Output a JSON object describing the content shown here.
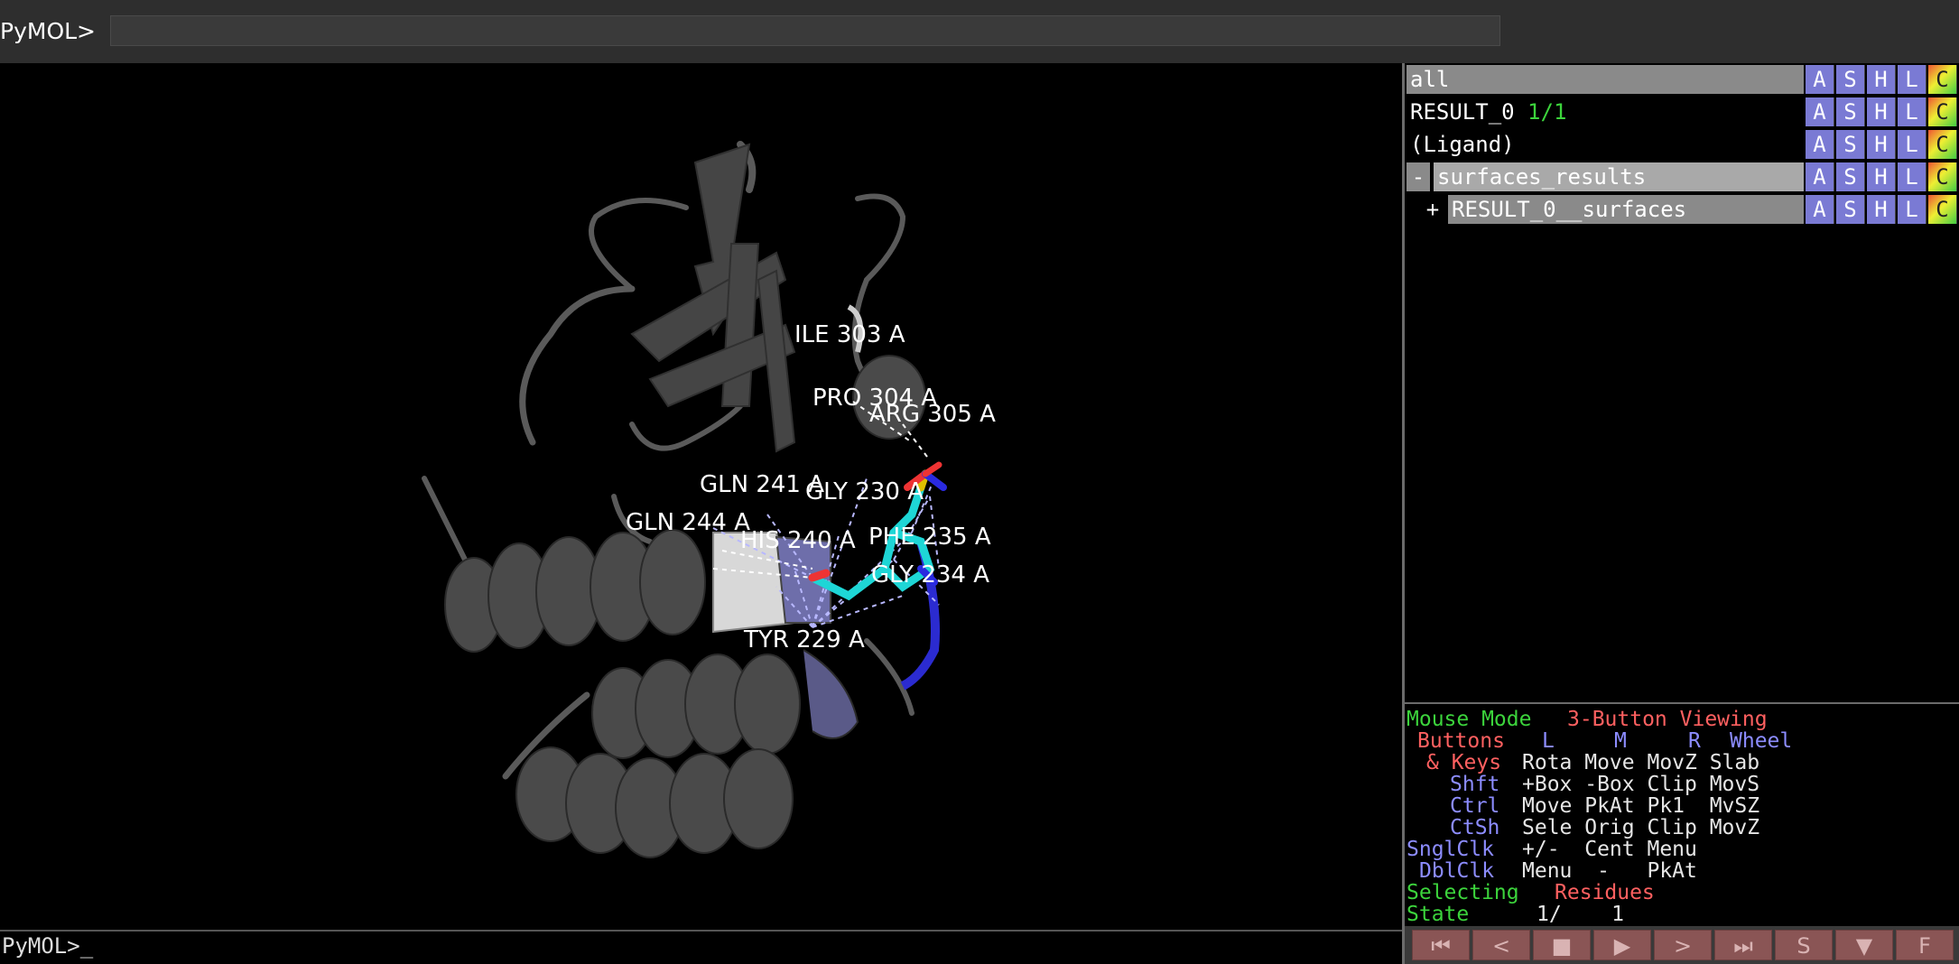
{
  "top": {
    "prompt": "PyMOL>",
    "command_value": ""
  },
  "bottom": {
    "prompt": "PyMOL>_"
  },
  "labels": {
    "ile303": "ILE 303 A",
    "pro304": "PRO 304 A",
    "arg305": "ARG 305 A",
    "gln241": "GLN 241 A",
    "gly230": "GLY 230 A",
    "gln244": "GLN 244 A",
    "his240": "HIS 240 A",
    "phe235": "PHE 235 A",
    "gly234": "GLY 234 A",
    "tyr229": "TYR 229 A"
  },
  "objects": [
    {
      "name": "all",
      "tree": "",
      "state": ""
    },
    {
      "name": "RESULT_0",
      "tree": "",
      "state": "1/1"
    },
    {
      "name": "(Ligand)",
      "tree": "",
      "state": ""
    },
    {
      "name": "surfaces_results",
      "tree": "-",
      "state": ""
    },
    {
      "name": "RESULT_0__surfaces",
      "tree": "+",
      "state": ""
    }
  ],
  "obj_buttons": {
    "a": "A",
    "s": "S",
    "h": "H",
    "l": "L",
    "c": "C"
  },
  "mouse": {
    "mode_label": "Mouse Mode",
    "mode_value": "3-Button Viewing",
    "buttons_label": "Buttons",
    "col_l": "L",
    "col_m": "M",
    "col_r": "R",
    "col_wheel": "Wheel",
    "keys_label": "& Keys",
    "keys_values": "Rota Move MovZ Slab",
    "shft_label": "Shft",
    "shft_values": "+Box -Box Clip MovS",
    "ctrl_label": "Ctrl",
    "ctrl_values": "Move PkAt Pk1  MvSZ",
    "ctsh_label": "CtSh",
    "ctsh_values": "Sele Orig Clip MovZ",
    "sngl_label": "SnglClk",
    "sngl_values": "+/-  Cent Menu",
    "dbl_label": "DblClk",
    "dbl_values": "Menu  -   PkAt",
    "selecting_label": "Selecting",
    "selecting_value": "Residues",
    "state_label": "State",
    "state_value": "1/    1"
  },
  "playback": {
    "rewind": "⏮",
    "back": "<",
    "stop": "■",
    "play": "▶",
    "forward": ">",
    "end": "⏭",
    "s": "S",
    "down": "▼",
    "f": "F"
  }
}
